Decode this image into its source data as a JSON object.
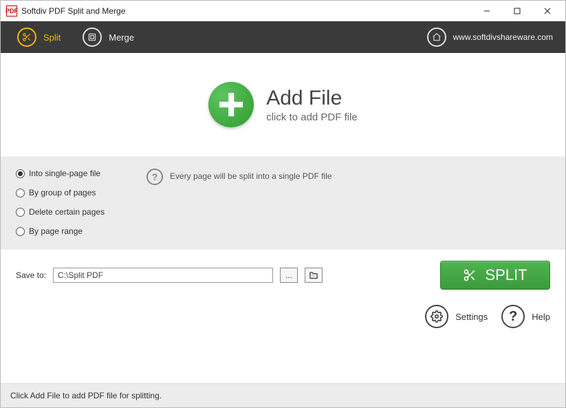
{
  "window": {
    "title": "Softdiv PDF Split and Merge"
  },
  "toolbar": {
    "split_label": "Split",
    "merge_label": "Merge",
    "site_url": "www.softdivshareware.com"
  },
  "addfile": {
    "heading": "Add File",
    "sub": "click to add PDF file"
  },
  "options": {
    "radios": [
      {
        "label": "Into single-page file",
        "selected": true
      },
      {
        "label": "By group of pages",
        "selected": false
      },
      {
        "label": "Delete certain pages",
        "selected": false
      },
      {
        "label": "By page range",
        "selected": false
      }
    ],
    "hint": "Every page will be split into a single PDF file"
  },
  "save": {
    "label": "Save to:",
    "path": "C:\\Split PDF",
    "more_btn": "...",
    "split_btn": "SPLIT"
  },
  "bottom": {
    "settings": "Settings",
    "help": "Help"
  },
  "status": "Click Add File to add PDF file for splitting."
}
